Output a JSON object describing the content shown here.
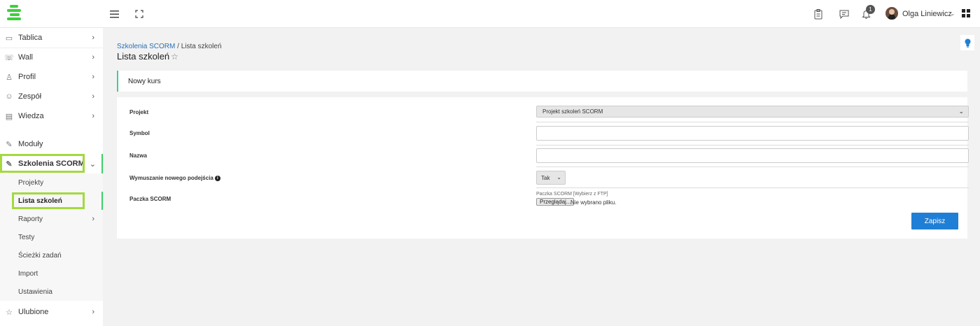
{
  "topbar": {
    "brand_color": "#3ecf3e",
    "menu_icon": "hamburger-icon",
    "fullscreen_icon": "fullscreen-icon",
    "clipboard_icon": "clipboard-icon",
    "chat_icon": "chat-icon",
    "bell_icon": "bell-icon",
    "notification_count": "1",
    "user_name": "Olga Liniewicz",
    "apps_icon": "apps-grid-icon"
  },
  "sidebar": {
    "items": [
      {
        "label": "Tablica",
        "icon": "monitor-icon"
      },
      {
        "label": "Wall",
        "icon": "wall-icon"
      },
      {
        "label": "Profil",
        "icon": "user-icon"
      },
      {
        "label": "Zespół",
        "icon": "team-icon"
      },
      {
        "label": "Wiedza",
        "icon": "book-icon"
      },
      {
        "label": "Moduły",
        "icon": "wrench-icon"
      },
      {
        "label": "Szkolenia SCORM",
        "icon": "wrench-icon"
      },
      {
        "label": "Ulubione",
        "icon": "star-icon"
      }
    ],
    "sub_items": [
      {
        "label": "Projekty"
      },
      {
        "label": "Lista szkoleń"
      },
      {
        "label": "Raporty"
      },
      {
        "label": "Testy"
      },
      {
        "label": "Ścieżki zadań"
      },
      {
        "label": "Import"
      },
      {
        "label": "Ustawienia"
      }
    ],
    "highlight_color": "#a3d93f"
  },
  "breadcrumb": {
    "link": "Szkolenia SCORM",
    "separator": " / ",
    "current": "Lista szkoleń"
  },
  "page_title": "Lista szkoleń",
  "card": {
    "heading": "Nowy kurs",
    "fields": {
      "projekt": {
        "label": "Projekt",
        "value": "Projekt szkoleń SCORM"
      },
      "symbol": {
        "label": "Symbol",
        "value": ""
      },
      "nazwa": {
        "label": "Nazwa",
        "value": ""
      },
      "wymuszanie": {
        "label": "Wymuszanie nowego podejścia",
        "value": "Tak"
      },
      "paczka": {
        "label": "Paczka SCORM",
        "hint": "Paczka SCORM [Wybierz z FTP]",
        "browse_label": "Przeglądaj...",
        "file_status": "Nie wybrano pliku."
      }
    },
    "save_label": "Zapisz"
  },
  "accent_blue": "#1f7fd6"
}
